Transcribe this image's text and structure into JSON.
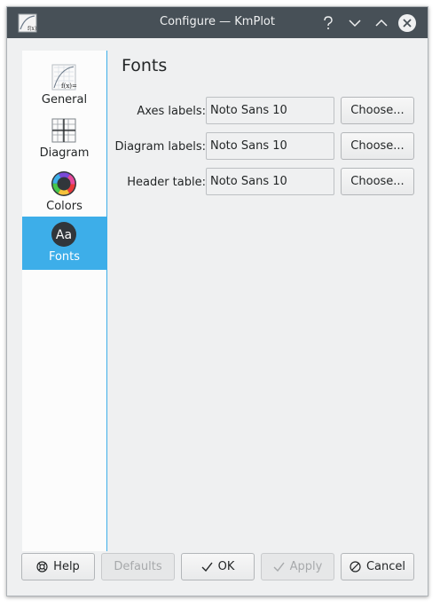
{
  "window": {
    "title": "Configure — KmPlot"
  },
  "sidebar": {
    "items": [
      {
        "label": "General",
        "icon": "general-icon",
        "selected": false
      },
      {
        "label": "Diagram",
        "icon": "diagram-icon",
        "selected": false
      },
      {
        "label": "Colors",
        "icon": "colors-icon",
        "selected": false
      },
      {
        "label": "Fonts",
        "icon": "fonts-icon",
        "selected": true
      }
    ]
  },
  "page": {
    "title": "Fonts",
    "rows": [
      {
        "label": "Axes labels:",
        "value": "Noto Sans 10",
        "button": "Choose..."
      },
      {
        "label": "Diagram labels:",
        "value": "Noto Sans 10",
        "button": "Choose..."
      },
      {
        "label": "Header table:",
        "value": "Noto Sans 10",
        "button": "Choose..."
      }
    ]
  },
  "buttons": {
    "help": "Help",
    "defaults": "Defaults",
    "ok": "OK",
    "apply": "Apply",
    "cancel": "Cancel"
  },
  "colors": {
    "accent": "#3daee9",
    "titlebar": "#475057",
    "window_bg": "#eff0f1"
  }
}
